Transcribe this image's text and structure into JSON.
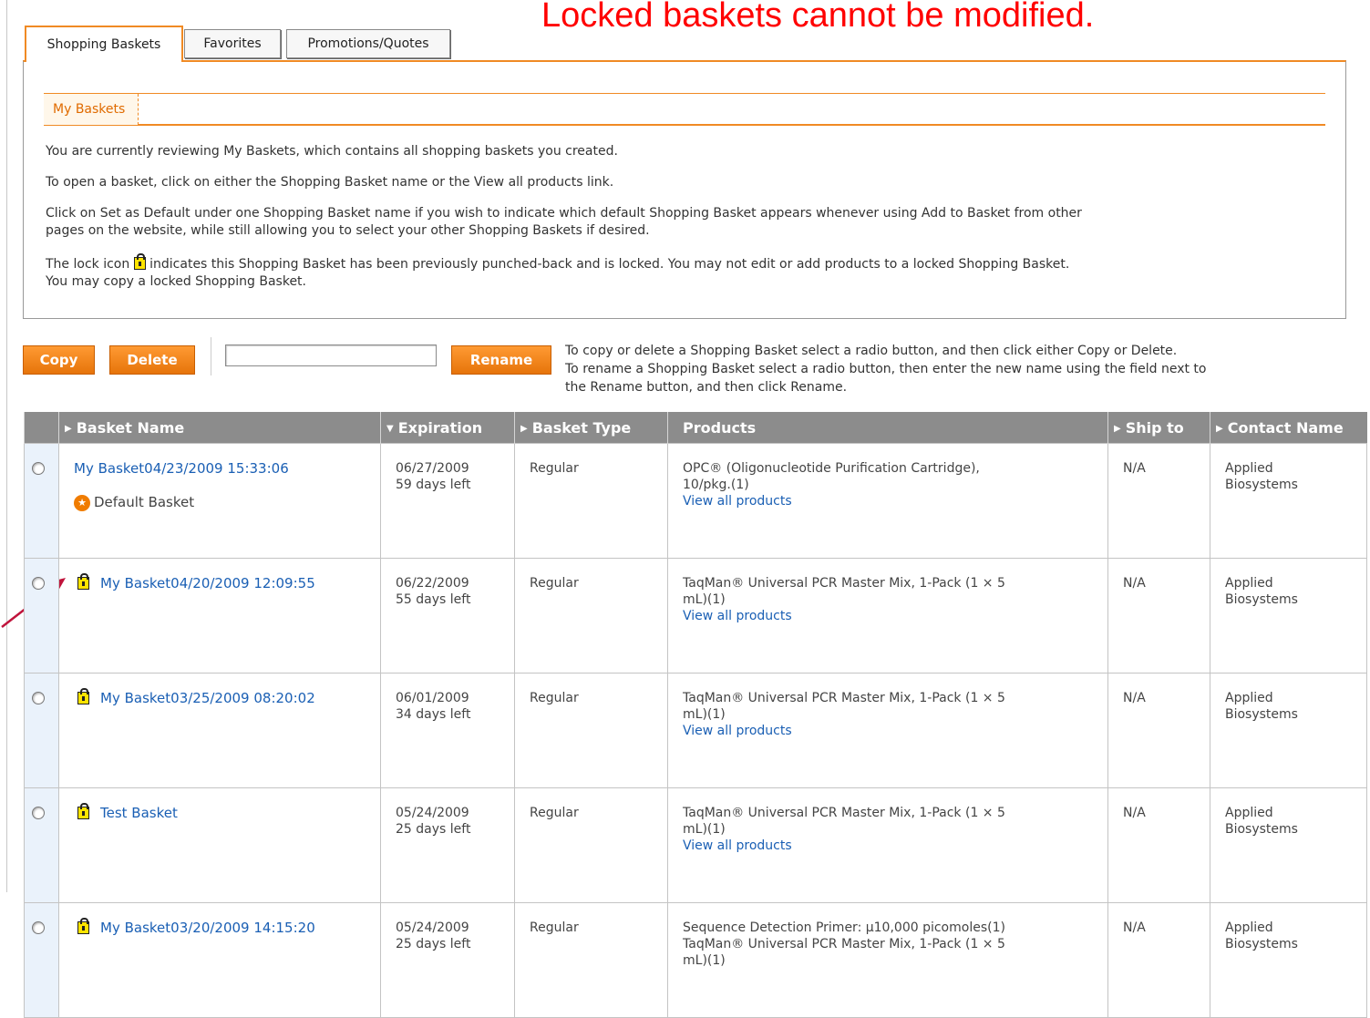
{
  "callout": "Locked baskets cannot be modified.",
  "tabs": [
    {
      "label": "Shopping Baskets",
      "active": true
    },
    {
      "label": "Favorites",
      "active": false
    },
    {
      "label": "Promotions/Quotes",
      "active": false
    }
  ],
  "subtab": "My Baskets",
  "info": {
    "p1": "You are currently reviewing My Baskets, which contains all shopping baskets you created.",
    "p2": "To open a basket, click on either the Shopping Basket name or the View all products link.",
    "p3a": "Click on Set as Default under one Shopping Basket name if you wish to indicate which default Shopping Basket appears whenever using Add to Basket from other",
    "p3b": "pages on the website, while still allowing you to select your other Shopping Baskets if desired.",
    "p4a_pre": "The lock icon",
    "p4a_post": "indicates this Shopping Basket has been previously punched-back and is locked. You may not edit or add products to a locked Shopping Basket.",
    "p4b": "You may copy a locked Shopping Basket."
  },
  "actions": {
    "copy": "Copy",
    "delete": "Delete",
    "rename": "Rename",
    "rename_value": "",
    "instr1": "To copy or delete a Shopping Basket select a radio button, and then click either Copy or Delete.",
    "instr2": "To rename a Shopping Basket select a radio button, then enter the new name using the field next to",
    "instr3": "the Rename button, and then click Rename."
  },
  "table": {
    "headers": {
      "name": "Basket Name",
      "expiration": "Expiration",
      "type": "Basket Type",
      "products": "Products",
      "ship": "Ship to",
      "contact": "Contact Name"
    },
    "view_all": "View all products",
    "default_label": "Default Basket",
    "rows": [
      {
        "name": "My Basket04/23/2009 15:33:06",
        "locked": false,
        "default": true,
        "date": "06/27/2009",
        "left": "59 days left",
        "type": "Regular",
        "prod1": "OPC® (Oligonucleotide Purification Cartridge),",
        "prod2": "10/pkg.(1)",
        "prod3": "",
        "ship": "N/A",
        "contact1": "Applied",
        "contact2": "Biosystems"
      },
      {
        "name": "My Basket04/20/2009 12:09:55",
        "locked": true,
        "default": false,
        "date": "06/22/2009",
        "left": "55 days left",
        "type": "Regular",
        "prod1": "TaqMan® Universal PCR Master Mix, 1-Pack (1 × 5",
        "prod2": "mL)(1)",
        "prod3": "",
        "ship": "N/A",
        "contact1": "Applied",
        "contact2": "Biosystems"
      },
      {
        "name": "My Basket03/25/2009 08:20:02",
        "locked": true,
        "default": false,
        "date": "06/01/2009",
        "left": "34 days left",
        "type": "Regular",
        "prod1": "TaqMan® Universal PCR Master Mix, 1-Pack (1 × 5",
        "prod2": "mL)(1)",
        "prod3": "",
        "ship": "N/A",
        "contact1": "Applied",
        "contact2": "Biosystems"
      },
      {
        "name": "Test Basket",
        "locked": true,
        "default": false,
        "date": "05/24/2009",
        "left": "25 days left",
        "type": "Regular",
        "prod1": "TaqMan® Universal PCR Master Mix, 1-Pack (1 × 5",
        "prod2": "mL)(1)",
        "prod3": "",
        "ship": "N/A",
        "contact1": "Applied",
        "contact2": "Biosystems"
      },
      {
        "name": "My Basket03/20/2009 14:15:20",
        "locked": true,
        "default": false,
        "date": "05/24/2009",
        "left": "25 days left",
        "type": "Regular",
        "prod1": "Sequence Detection Primer: µ10,000 picomoles(1)",
        "prod2": "TaqMan® Universal PCR Master Mix, 1-Pack (1 × 5",
        "prod3": "mL)(1)",
        "ship": "N/A",
        "contact1": "Applied",
        "contact2": "Biosystems"
      }
    ]
  },
  "colors": {
    "accent": "#f08a24",
    "callout": "#ff0000",
    "link": "#1a5fb4",
    "header_bg": "#8c8c8c"
  }
}
